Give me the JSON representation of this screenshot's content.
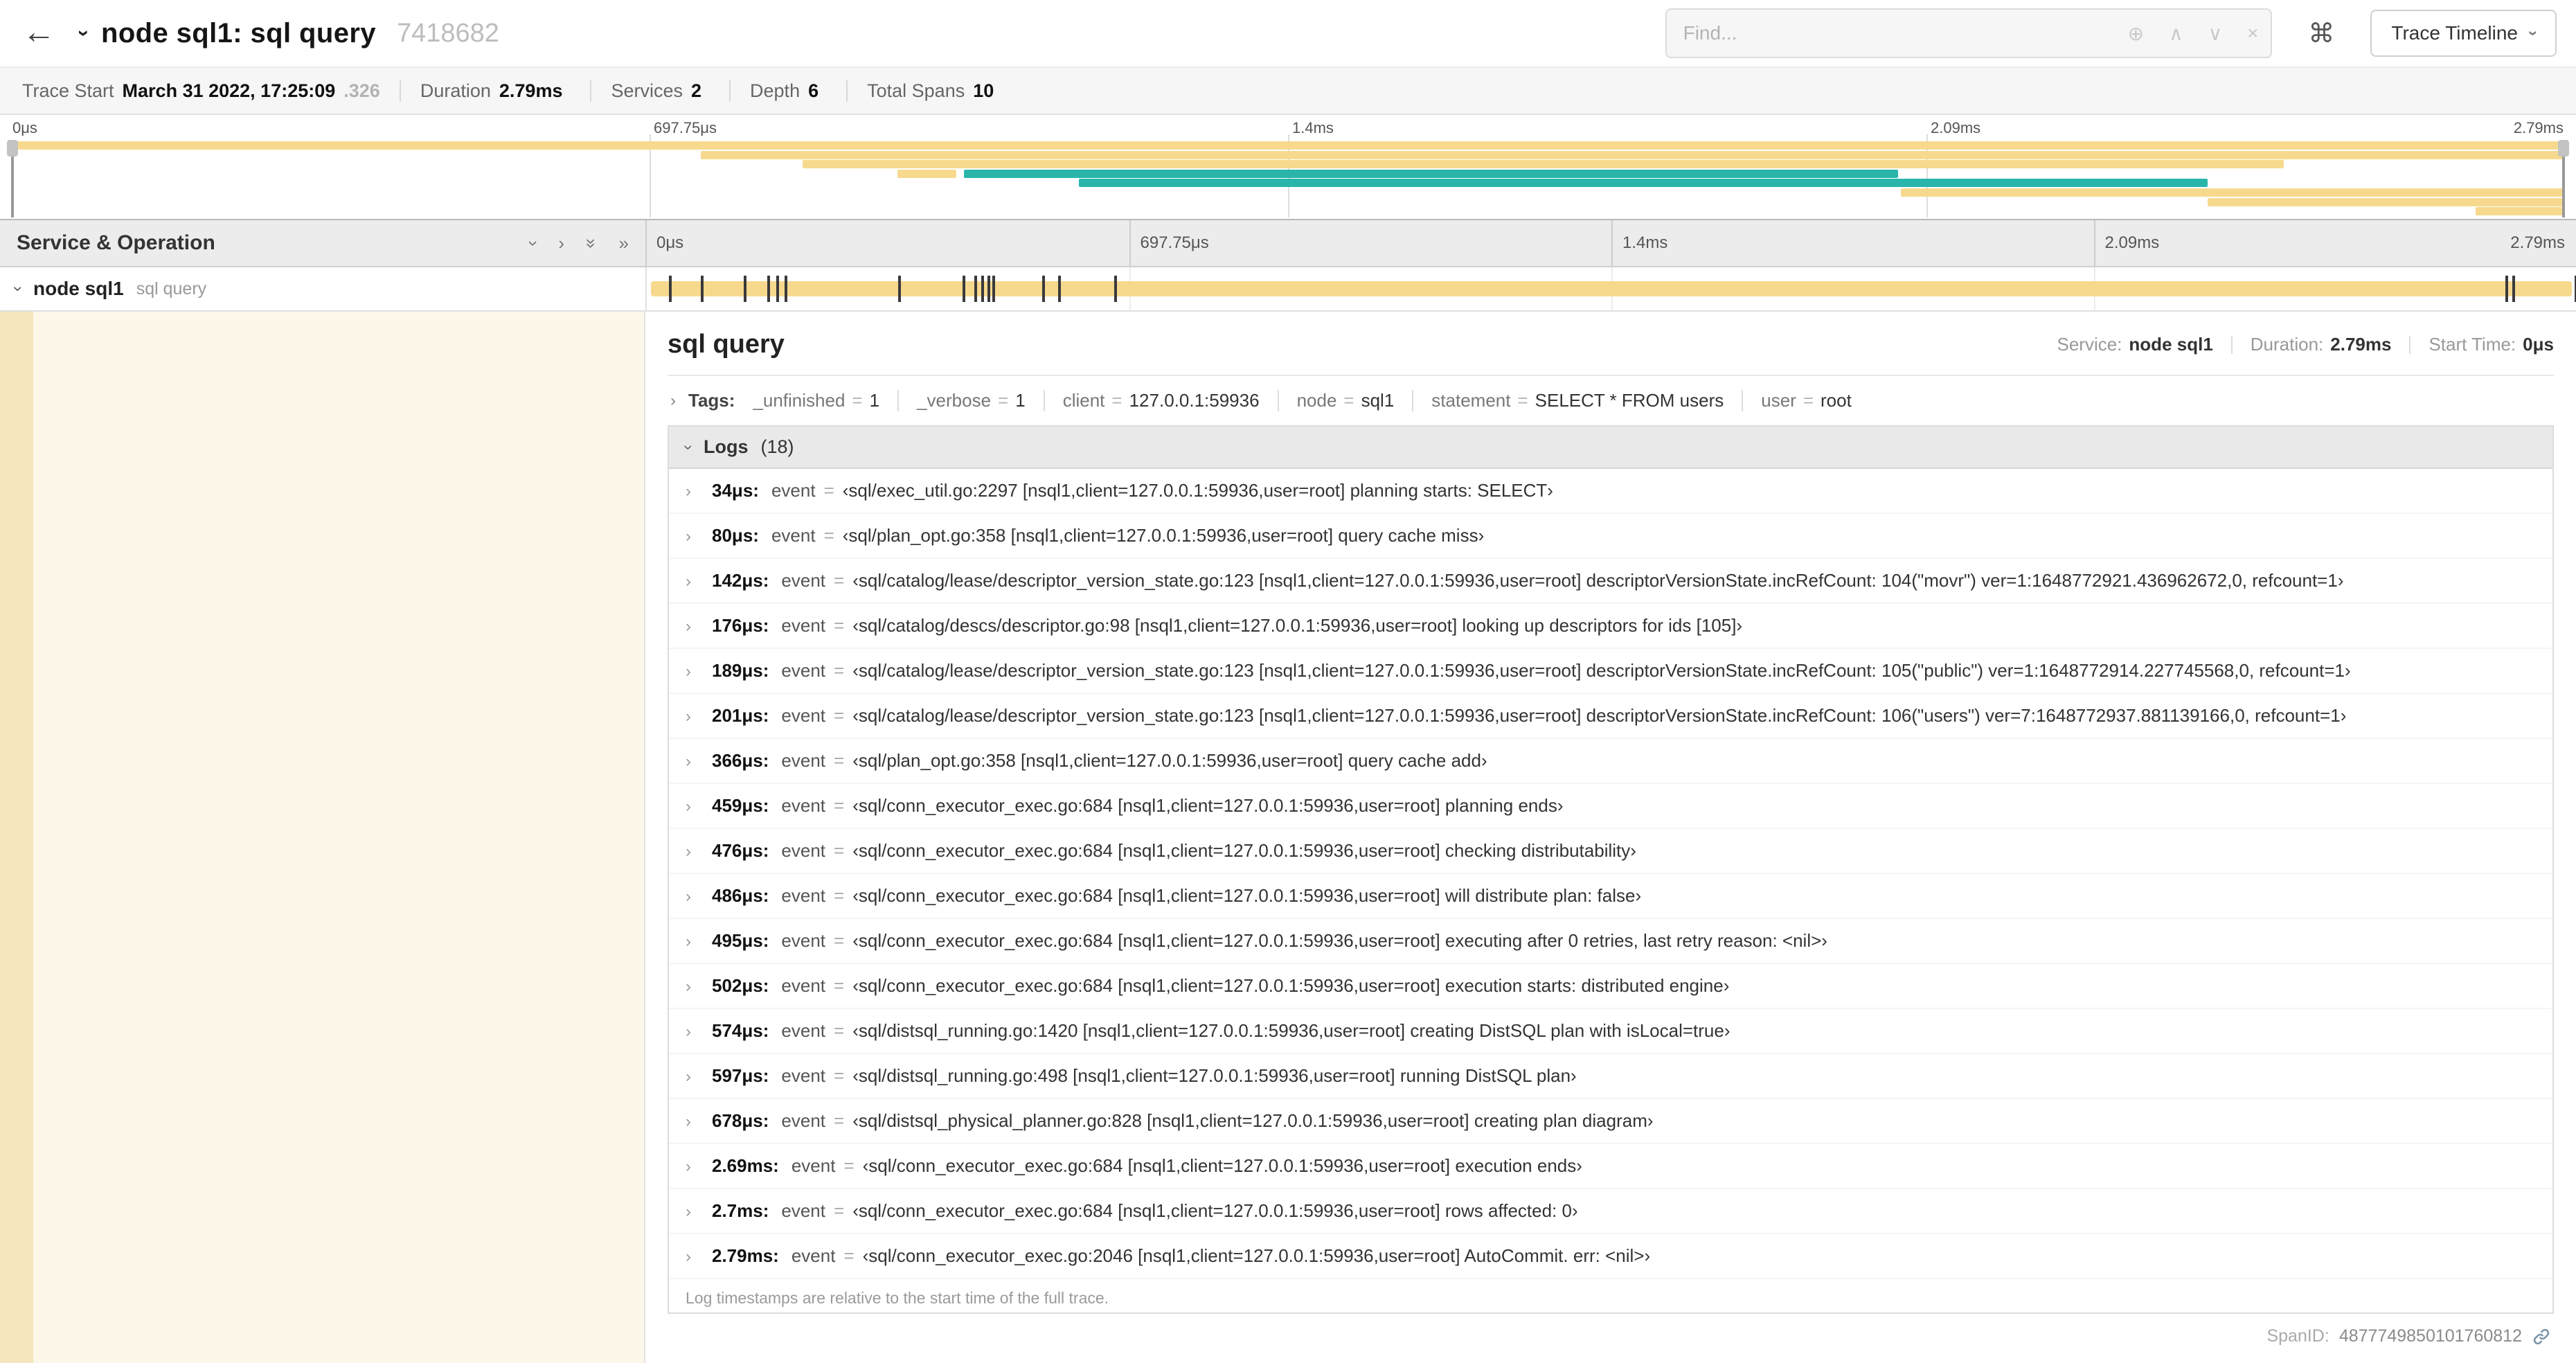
{
  "icons": {
    "back": "←",
    "chevron": "›",
    "double_chevron": "»",
    "target": "⊕",
    "up": "∧",
    "down": "∨",
    "close": "×",
    "keyboard": "⌘"
  },
  "colors": {
    "span_tan": "#f7d98e",
    "span_teal": "#2ab5ab",
    "tree_bg": "#fdf7e9",
    "tree_stripe": "#f6e6bd"
  },
  "header": {
    "title": "node sql1: sql query",
    "trace_id": "7418682",
    "find_placeholder": "Find...",
    "view_button": "Trace Timeline"
  },
  "trace_info": {
    "items": [
      {
        "label": "Trace Start",
        "value": "March 31 2022, 17:25:09",
        "extra": ".326"
      },
      {
        "label": "Duration",
        "value": "2.79ms",
        "extra": ""
      },
      {
        "label": "Services",
        "value": "2",
        "extra": ""
      },
      {
        "label": "Depth",
        "value": "6",
        "extra": ""
      },
      {
        "label": "Total Spans",
        "value": "10",
        "extra": ""
      }
    ]
  },
  "time_axis": {
    "ticks": [
      "0μs",
      "697.75μs",
      "1.4ms",
      "2.09ms",
      "2.79ms"
    ]
  },
  "minimap": {
    "spans": [
      {
        "row": 0,
        "start": 0,
        "width": 100,
        "color": "tan"
      },
      {
        "row": 1,
        "start": 27,
        "width": 73,
        "color": "tan"
      },
      {
        "row": 2,
        "start": 31,
        "width": 58,
        "color": "tan"
      },
      {
        "row": 3,
        "start": 34.7,
        "width": 2.3,
        "color": "tan"
      },
      {
        "row": 3,
        "start": 37.3,
        "width": 36.6,
        "color": "teal"
      },
      {
        "row": 4,
        "start": 41.8,
        "width": 44.2,
        "color": "teal"
      },
      {
        "row": 5,
        "start": 74,
        "width": 26,
        "color": "tan"
      },
      {
        "row": 6,
        "start": 86,
        "width": 14,
        "color": "tan"
      },
      {
        "row": 7,
        "start": 96.5,
        "width": 3.5,
        "color": "tan"
      }
    ]
  },
  "timeline": {
    "left_header": "Service & Operation",
    "row": {
      "service": "node sql1",
      "operation": "sql query"
    }
  },
  "detail": {
    "title": "sql query",
    "service_label": "Service:",
    "service": "node sql1",
    "duration_label": "Duration:",
    "duration": "2.79ms",
    "start_label": "Start Time:",
    "start": "0μs",
    "tags_label": "Tags:",
    "equals": "=",
    "tags": [
      {
        "key": "_unfinished",
        "value": "1"
      },
      {
        "key": "_verbose",
        "value": "1"
      },
      {
        "key": "client",
        "value": "127.0.0.1:59936"
      },
      {
        "key": "node",
        "value": "sql1"
      },
      {
        "key": "statement",
        "value": "SELECT * FROM users"
      },
      {
        "key": "user",
        "value": "root"
      }
    ],
    "logs_label": "Logs",
    "logs_count": "(18)",
    "log_key": "event",
    "logs": [
      {
        "time": "34μs:",
        "msg": "‹sql/exec_util.go:2297 [nsql1,client=127.0.0.1:59936,user=root] planning starts: SELECT›"
      },
      {
        "time": "80μs:",
        "msg": "‹sql/plan_opt.go:358 [nsql1,client=127.0.0.1:59936,user=root] query cache miss›"
      },
      {
        "time": "142μs:",
        "msg": "‹sql/catalog/lease/descriptor_version_state.go:123 [nsql1,client=127.0.0.1:59936,user=root] descriptorVersionState.incRefCount: 104(\"movr\") ver=1:1648772921.436962672,0, refcount=1›"
      },
      {
        "time": "176μs:",
        "msg": "‹sql/catalog/descs/descriptor.go:98 [nsql1,client=127.0.0.1:59936,user=root] looking up descriptors for ids [105]›"
      },
      {
        "time": "189μs:",
        "msg": "‹sql/catalog/lease/descriptor_version_state.go:123 [nsql1,client=127.0.0.1:59936,user=root] descriptorVersionState.incRefCount: 105(\"public\") ver=1:1648772914.227745568,0, refcount=1›"
      },
      {
        "time": "201μs:",
        "msg": "‹sql/catalog/lease/descriptor_version_state.go:123 [nsql1,client=127.0.0.1:59936,user=root] descriptorVersionState.incRefCount: 106(\"users\") ver=7:1648772937.881139166,0, refcount=1›"
      },
      {
        "time": "366μs:",
        "msg": "‹sql/plan_opt.go:358 [nsql1,client=127.0.0.1:59936,user=root] query cache add›"
      },
      {
        "time": "459μs:",
        "msg": "‹sql/conn_executor_exec.go:684 [nsql1,client=127.0.0.1:59936,user=root] planning ends›"
      },
      {
        "time": "476μs:",
        "msg": "‹sql/conn_executor_exec.go:684 [nsql1,client=127.0.0.1:59936,user=root] checking distributability›"
      },
      {
        "time": "486μs:",
        "msg": "‹sql/conn_executor_exec.go:684 [nsql1,client=127.0.0.1:59936,user=root] will distribute plan: false›"
      },
      {
        "time": "495μs:",
        "msg": "‹sql/conn_executor_exec.go:684 [nsql1,client=127.0.0.1:59936,user=root] executing after 0 retries, last retry reason: <nil>›"
      },
      {
        "time": "502μs:",
        "msg": "‹sql/conn_executor_exec.go:684 [nsql1,client=127.0.0.1:59936,user=root] execution starts: distributed engine›"
      },
      {
        "time": "574μs:",
        "msg": "‹sql/distsql_running.go:1420 [nsql1,client=127.0.0.1:59936,user=root] creating DistSQL plan with isLocal=true›"
      },
      {
        "time": "597μs:",
        "msg": "‹sql/distsql_running.go:498 [nsql1,client=127.0.0.1:59936,user=root] running DistSQL plan›"
      },
      {
        "time": "678μs:",
        "msg": "‹sql/distsql_physical_planner.go:828 [nsql1,client=127.0.0.1:59936,user=root] creating plan diagram›"
      },
      {
        "time": "2.69ms:",
        "msg": "‹sql/conn_executor_exec.go:684 [nsql1,client=127.0.0.1:59936,user=root] execution ends›"
      },
      {
        "time": "2.7ms:",
        "msg": "‹sql/conn_executor_exec.go:684 [nsql1,client=127.0.0.1:59936,user=root] rows affected: 0›"
      },
      {
        "time": "2.79ms:",
        "msg": "‹sql/conn_executor_exec.go:2046 [nsql1,client=127.0.0.1:59936,user=root] AutoCommit. err: <nil>›"
      }
    ],
    "logs_footer": "Log timestamps are relative to the start time of the full trace.",
    "span_id_label": "SpanID:",
    "span_id": "4877749850101760812"
  }
}
